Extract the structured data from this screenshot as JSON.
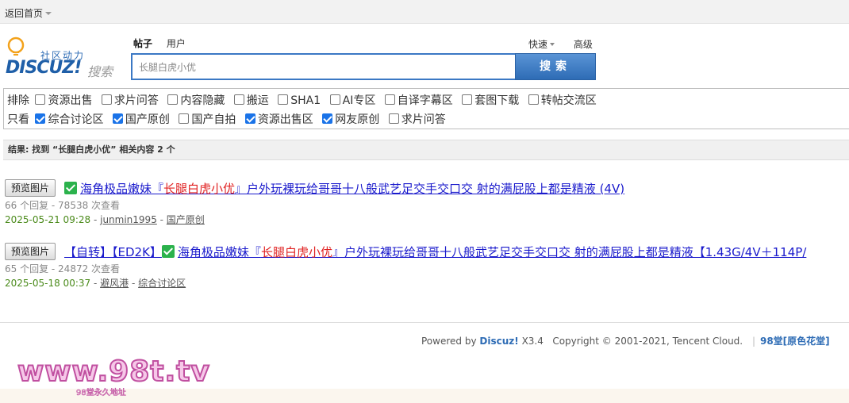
{
  "topbar": {
    "home_label": "返回首页"
  },
  "logo": {
    "cn_text": "社区动力",
    "en_text": "DISCUZ!",
    "sou_text": "搜索"
  },
  "search": {
    "tabs": [
      {
        "label": "帖子",
        "active": true
      },
      {
        "label": "用户",
        "active": false
      }
    ],
    "quick_label": "快速",
    "advanced_label": "高级",
    "query": "长腿白虎小优",
    "button_label": "搜索"
  },
  "filters": {
    "exclude_label": "排除",
    "exclude_options": [
      {
        "label": "资源出售",
        "checked": false
      },
      {
        "label": "求片问答",
        "checked": false
      },
      {
        "label": "内容隐藏",
        "checked": false
      },
      {
        "label": "搬运",
        "checked": false
      },
      {
        "label": "SHA1",
        "checked": false
      },
      {
        "label": "AI专区",
        "checked": false
      },
      {
        "label": "自译字幕区",
        "checked": false
      },
      {
        "label": "套图下载",
        "checked": false
      },
      {
        "label": "转帖交流区",
        "checked": false
      }
    ],
    "only_label": "只看",
    "only_options": [
      {
        "label": "综合讨论区",
        "checked": true
      },
      {
        "label": "国产原创",
        "checked": true
      },
      {
        "label": "国产自拍",
        "checked": false
      },
      {
        "label": "资源出售区",
        "checked": true
      },
      {
        "label": "网友原创",
        "checked": true
      },
      {
        "label": "求片问答",
        "checked": false
      }
    ]
  },
  "results_header": "结果: 找到 “长腿白虎小优” 相关内容 2 个",
  "results": [
    {
      "preview_label": "预览图片",
      "title_before": "海角极品嫩妹『",
      "title_highlight": "长腿白虎小优",
      "title_after": "』户外玩裸玩给哥哥十八般武艺足交手交口交 射的满屁股上都是精液 (4V)",
      "stats": "66 个回复 - 78538 次查看",
      "date": "2025-05-21 09:28",
      "author": "junmin1995",
      "forum": "国产原创"
    },
    {
      "preview_label": "预览图片",
      "title_prefix": "【自转】【ED2K】",
      "title_before": "海角极品嫩妹『",
      "title_highlight": "长腿白虎小优",
      "title_after": "』户外玩裸玩给哥哥十八般武艺足交手交口交 射的满屁股上都是精液【1.43G/4V＋114P/",
      "stats": "65 个回复 - 24872 次查看",
      "date": "2025-05-18 00:37",
      "author": "避风港",
      "forum": "综合讨论区"
    }
  ],
  "footer": {
    "powered": "Powered by",
    "brand": "Discuz!",
    "version": "X3.4",
    "copyright": "Copyright © 2001-2021, Tencent Cloud.",
    "site": "98堂[原色花堂]"
  },
  "watermark": {
    "big": "www.98t.tv",
    "small": "98堂永久地址"
  },
  "colors": {
    "accent": "#2e6cb5",
    "link": "#1a1acc",
    "highlight": "#e02020",
    "date": "#4a8a1a",
    "check": "#2bb24c"
  }
}
